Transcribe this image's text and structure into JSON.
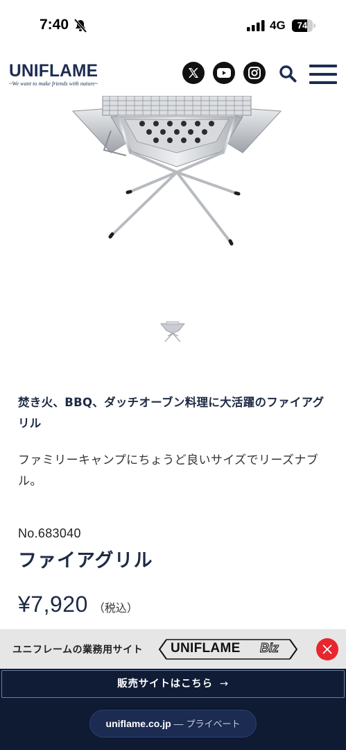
{
  "status_bar": {
    "time": "7:40",
    "network": "4G",
    "battery": "74",
    "battery_level": 0.74
  },
  "header": {
    "logo_text": "UNIFLAME",
    "logo_tagline": "~We want to make friends with nature~",
    "icons": [
      "x-icon",
      "youtube-icon",
      "instagram-icon",
      "search-icon",
      "menu-icon"
    ]
  },
  "product": {
    "headline": "焚き火、BBQ、ダッチオーブン料理に大活躍のファイアグリル",
    "description": "ファミリーキャンプにちょうど良いサイズでリーズナブル。",
    "number": "No.683040",
    "name": "ファイアグリル",
    "price": "¥7,920",
    "tax_note": "（税込）"
  },
  "biz_banner": {
    "text": "ユニフレームの業務用サイト",
    "logo_word": "UNIFLAME",
    "logo_suffix": "Biz",
    "close_color": "#e8262d"
  },
  "shop_button": {
    "label": "販売サイトはこちら",
    "arrow": "→"
  },
  "browser_bar": {
    "host": "uniflame.co.jp",
    "separator": " — ",
    "mode": "プライベート"
  },
  "colors": {
    "brand_navy": "#1c2c52",
    "bottom_bar": "#0f1a33",
    "close_red": "#e8262d"
  }
}
